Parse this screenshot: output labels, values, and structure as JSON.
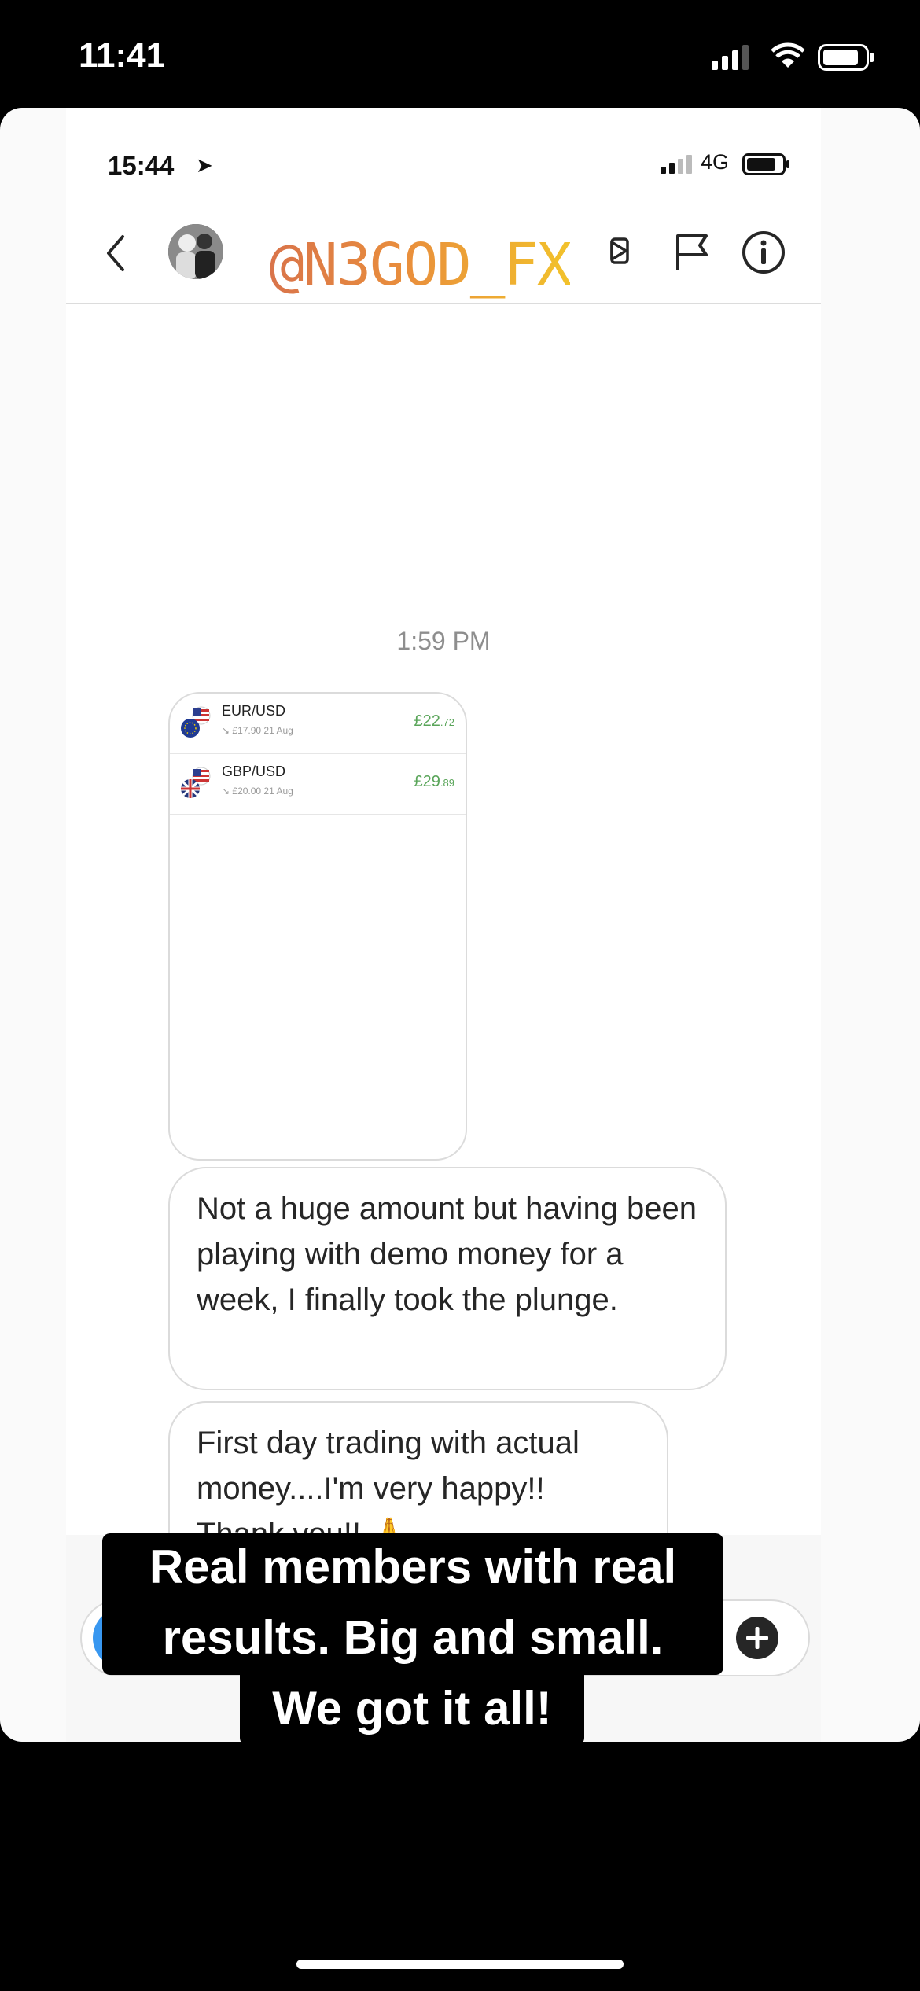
{
  "outer_status": {
    "time": "11:41"
  },
  "app_status": {
    "time": "15:44",
    "network": "4G"
  },
  "story": {
    "handle": "@N3GOD_FX"
  },
  "conversation": {
    "timestamp": "1:59 PM",
    "trades": [
      {
        "pair": "EUR/USD",
        "detail": "↘ £17.90  21 Aug",
        "value_main": "£22",
        "value_fraction": ".72"
      },
      {
        "pair": "GBP/USD",
        "detail": "↘ £20.00  21 Aug",
        "value_main": "£29",
        "value_fraction": ".89"
      }
    ],
    "messages": [
      "Not a huge amount but having been playing with demo money for a week, I finally took the plunge.",
      "First day trading with actual money....I'm very happy!! Thank you!! 🙏"
    ]
  },
  "caption": {
    "line1": "Real members with real",
    "line2": "results. Big and small.",
    "line3": "We got it all!"
  }
}
